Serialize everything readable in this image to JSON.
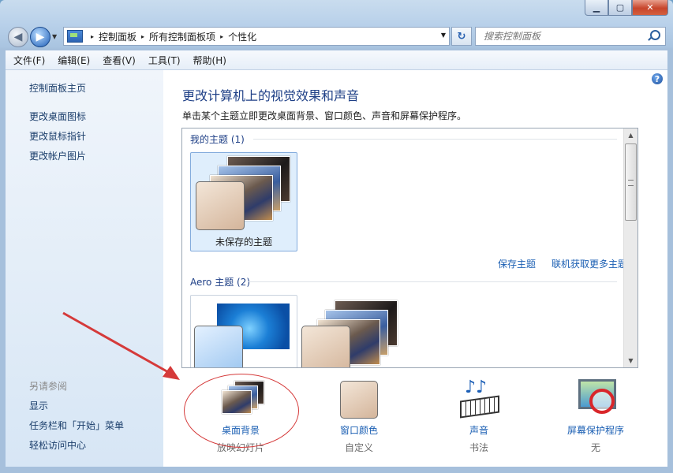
{
  "window": {
    "min_label": "▁",
    "max_label": "▢",
    "close_label": "✕"
  },
  "address": {
    "breadcrumbs": [
      "控制面板",
      "所有控制面板项",
      "个性化"
    ],
    "separator": "▸",
    "back_label": "◀",
    "forward_label": "▶",
    "refresh_label": "↻"
  },
  "search": {
    "placeholder": "搜索控制面板"
  },
  "menu": [
    "文件(F)",
    "编辑(E)",
    "查看(V)",
    "工具(T)",
    "帮助(H)"
  ],
  "sidebar": {
    "home": "控制面板主页",
    "links": [
      "更改桌面图标",
      "更改鼠标指针",
      "更改帐户图片"
    ],
    "see_also_label": "另请参阅",
    "see_also": [
      "显示",
      "任务栏和「开始」菜单",
      "轻松访问中心"
    ]
  },
  "main": {
    "title": "更改计算机上的视觉效果和声音",
    "subtitle": "单击某个主题立即更改桌面背景、窗口颜色、声音和屏幕保护程序。",
    "help_label": "?"
  },
  "themes": {
    "my_group_label": "我的主题 (1)",
    "unsaved_theme_label": "未保存的主题",
    "save_link": "保存主题",
    "online_link": "联机获取更多主题",
    "aero_group_label": "Aero 主题 (2)"
  },
  "tools": [
    {
      "label": "桌面背景",
      "sub": "放映幻灯片"
    },
    {
      "label": "窗口颜色",
      "sub": "自定义"
    },
    {
      "label": "声音",
      "sub": "书法"
    },
    {
      "label": "屏幕保护程序",
      "sub": "无"
    }
  ],
  "colors": {
    "link": "#1b5fb3",
    "title": "#1e3f86",
    "annotation_red": "#d53a3a"
  }
}
